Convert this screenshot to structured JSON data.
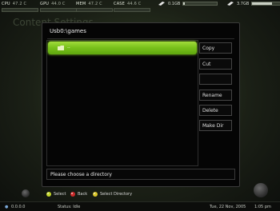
{
  "system": {
    "cpu": {
      "label": "CPU",
      "value": "47.2 C"
    },
    "gpu": {
      "label": "GPU",
      "value": "44.0 C"
    },
    "mem": {
      "label": "MEM",
      "value": "47.2 C"
    },
    "case": {
      "label": "CASE",
      "value": "44.6 C"
    }
  },
  "drives": [
    {
      "label": "0.1GB",
      "fill": 0.05
    },
    {
      "label": "3.7GB",
      "fill": 0.6
    }
  ],
  "background_title": "Content Settings",
  "dialog": {
    "title": "Usb0:\\games",
    "selected_item": "..",
    "buttons": [
      "Copy",
      "Cut",
      "",
      "Rename",
      "Delete",
      "Make Dir"
    ],
    "status_text": "Please choose a directory"
  },
  "hints": [
    {
      "label": "Select",
      "color": "#c4d62a"
    },
    {
      "label": "Back",
      "color": "#cc2a2a"
    },
    {
      "label": "Select Directory",
      "color": "#d9c52a"
    }
  ],
  "footer": {
    "ip": "0.0.0.0",
    "status": "Status: Idle",
    "date": "Tue, 22 Nov, 2005",
    "time": "1:05 pm"
  }
}
